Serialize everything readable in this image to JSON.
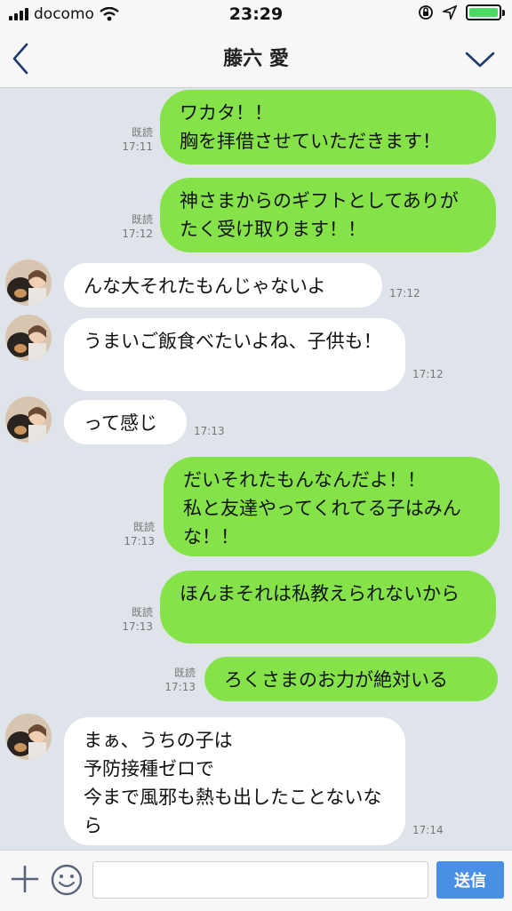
{
  "status": {
    "carrier": "docomo",
    "time": "23:29"
  },
  "header": {
    "title": "藤六 愛"
  },
  "messages": [
    {
      "side": "right",
      "read": "既読",
      "time": "17:11",
      "text": "ワカタ！！\n胸を拝借させていただきます！"
    },
    {
      "side": "right",
      "read": "既読",
      "time": "17:12",
      "text": "神さまからのギフトとしてありがたく受け取ります！！"
    },
    {
      "side": "left",
      "time": "17:12",
      "text": "んな大それたもんじゃないよ"
    },
    {
      "side": "left",
      "time": "17:12",
      "text": "うまいご飯食べたいよね、子供も！"
    },
    {
      "side": "left",
      "time": "17:13",
      "text": "って感じ"
    },
    {
      "side": "right",
      "read": "既読",
      "time": "17:13",
      "text": "だいそれたもんなんだよ！！\n私と友達やってくれてる子はみんな！！"
    },
    {
      "side": "right",
      "read": "既読",
      "time": "17:13",
      "text": "ほんまそれは私教えられないから"
    },
    {
      "side": "right",
      "read": "既読",
      "time": "17:13",
      "text": "ろくさまのお力が絶対いる"
    },
    {
      "side": "left",
      "time": "17:14",
      "text": "まぁ、うちの子は\n予防接種ゼロで\n今まで風邪も熱も出したことないなら"
    }
  ],
  "input": {
    "placeholder": "",
    "send_label": "送信"
  },
  "colors": {
    "bubble_right": "#85e249",
    "bubble_left": "#ffffff",
    "background": "#dfe3ea",
    "send": "#4a8fe6"
  }
}
